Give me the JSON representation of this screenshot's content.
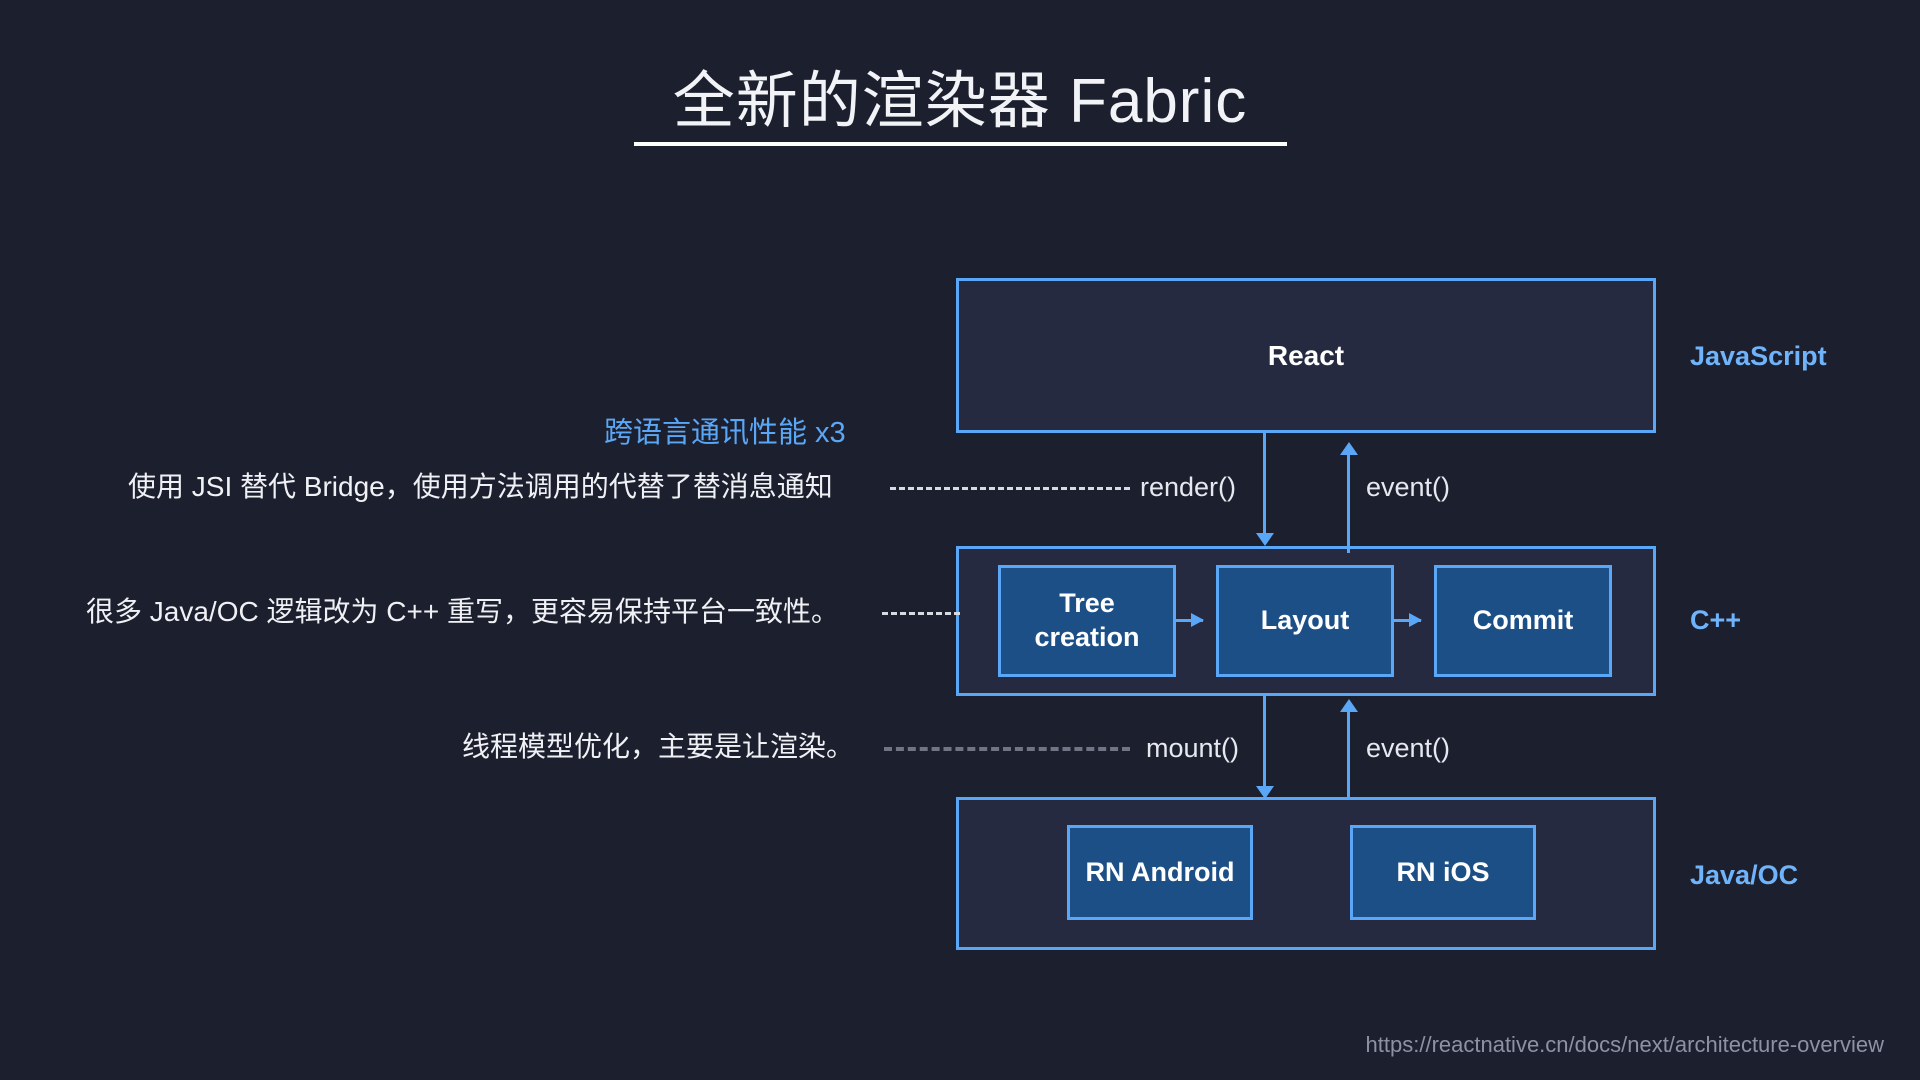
{
  "slide": {
    "title": "全新的渲染器 Fabric",
    "footer_url": "https://reactnative.cn/docs/next/architecture-overview"
  },
  "annotations": {
    "highlight": "跨语言通讯性能 x3",
    "line1": "使用 JSI 替代  Bridge，使用方法调用的代替了替消息通知",
    "line2": "很多 Java/OC 逻辑改为 C++ 重写，更容易保持平台一致性。",
    "line3": "线程模型优化，主要是让渲染。"
  },
  "diagram": {
    "layers": [
      {
        "id": "javascript",
        "box_label": "React",
        "platform_label": "JavaScript"
      },
      {
        "id": "cpp",
        "box_label": "",
        "platform_label": "C++"
      },
      {
        "id": "native",
        "box_label": "",
        "platform_label": "Java/OC"
      }
    ],
    "cpp_stages": [
      {
        "label": "Tree\ncreation",
        "line1": "Tree",
        "line2": "creation"
      },
      {
        "label": "Layout"
      },
      {
        "label": "Commit"
      }
    ],
    "native_targets": [
      {
        "label": "RN Android"
      },
      {
        "label": "RN iOS"
      }
    ],
    "arrows": {
      "render": "render()",
      "event_top": "event()",
      "mount": "mount()",
      "event_bottom": "event()"
    }
  },
  "colors": {
    "background": "#1c1f2e",
    "accent_blue": "#5ba7f7",
    "platform_label": "#6fb4fb",
    "layer_fill": "#252a40",
    "sub_box_fill": "#1d4f87",
    "text": "#ffffff",
    "footer": "#8d92a3"
  }
}
